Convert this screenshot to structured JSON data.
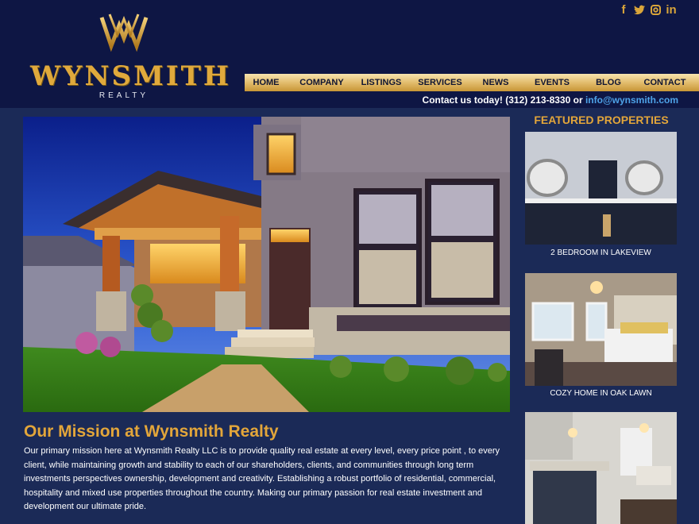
{
  "brand": {
    "name": "WYNSMITH",
    "sub": "REALTY"
  },
  "social": [
    "f",
    "t",
    "ig",
    "in"
  ],
  "nav": [
    "HOME",
    "COMPANY",
    "LISTINGS",
    "SERVICES",
    "NEWS",
    "EVENTS",
    "BLOG",
    "CONTACT"
  ],
  "contact": {
    "lead": "Contact us today! (312) 213-8330 or ",
    "email": "info@wynsmith.com"
  },
  "mission": {
    "title": "Our Mission at Wynsmith Realty",
    "body": "Our primary mission here at Wynsmith Realty LLC is to provide quality real estate at every level, every price point , to every client, while maintaining growth and stability to each of our shareholders, clients, and communities through long term investments perspectives ownership, development and creativity. Establishing a robust portfolio of residential, commercial, hospitality and mixed use properties throughout the country. Making our primary passion for real estate investment and development our ultimate pride."
  },
  "featured": {
    "title": "FEATURED PROPERTIES",
    "items": [
      {
        "caption": "2 BEDROOM IN LAKEVIEW"
      },
      {
        "caption": "COZY HOME IN OAK LAWN"
      },
      {
        "caption": ""
      }
    ]
  },
  "colors": {
    "header_bg": "#0e1644",
    "page_bg": "#1b2a57",
    "gold": "#e3a63a",
    "link": "#4ea3e8"
  }
}
